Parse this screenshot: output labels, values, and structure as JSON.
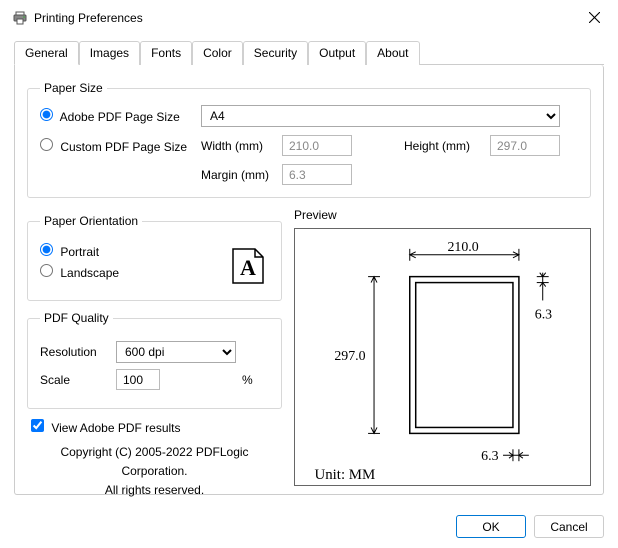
{
  "window": {
    "title": "Printing Preferences"
  },
  "tabs": [
    "General",
    "Images",
    "Fonts",
    "Color",
    "Security",
    "Output",
    "About"
  ],
  "paperSize": {
    "legend": "Paper Size",
    "adobeLabel": "Adobe PDF Page Size",
    "customLabel": "Custom PDF Page Size",
    "selected": "A4",
    "widthLabel": "Width (mm)",
    "heightLabel": "Height (mm)",
    "marginLabel": "Margin (mm)",
    "width": "210.0",
    "height": "297.0",
    "margin": "6.3"
  },
  "orientation": {
    "legend": "Paper Orientation",
    "portrait": "Portrait",
    "landscape": "Landscape"
  },
  "quality": {
    "legend": "PDF Quality",
    "resolutionLabel": "Resolution",
    "resolution": "600 dpi",
    "scaleLabel": "Scale",
    "scale": "100",
    "percent": "%"
  },
  "preview": {
    "legend": "Preview",
    "width": "210.0",
    "height": "297.0",
    "margin": "6.3",
    "unitLabel": "Unit: MM"
  },
  "viewResults": "View Adobe PDF results",
  "copyright1": "Copyright (C) 2005-2022 PDFLogic Corporation.",
  "copyright2": "All rights reserved.",
  "buttons": {
    "ok": "OK",
    "cancel": "Cancel"
  }
}
